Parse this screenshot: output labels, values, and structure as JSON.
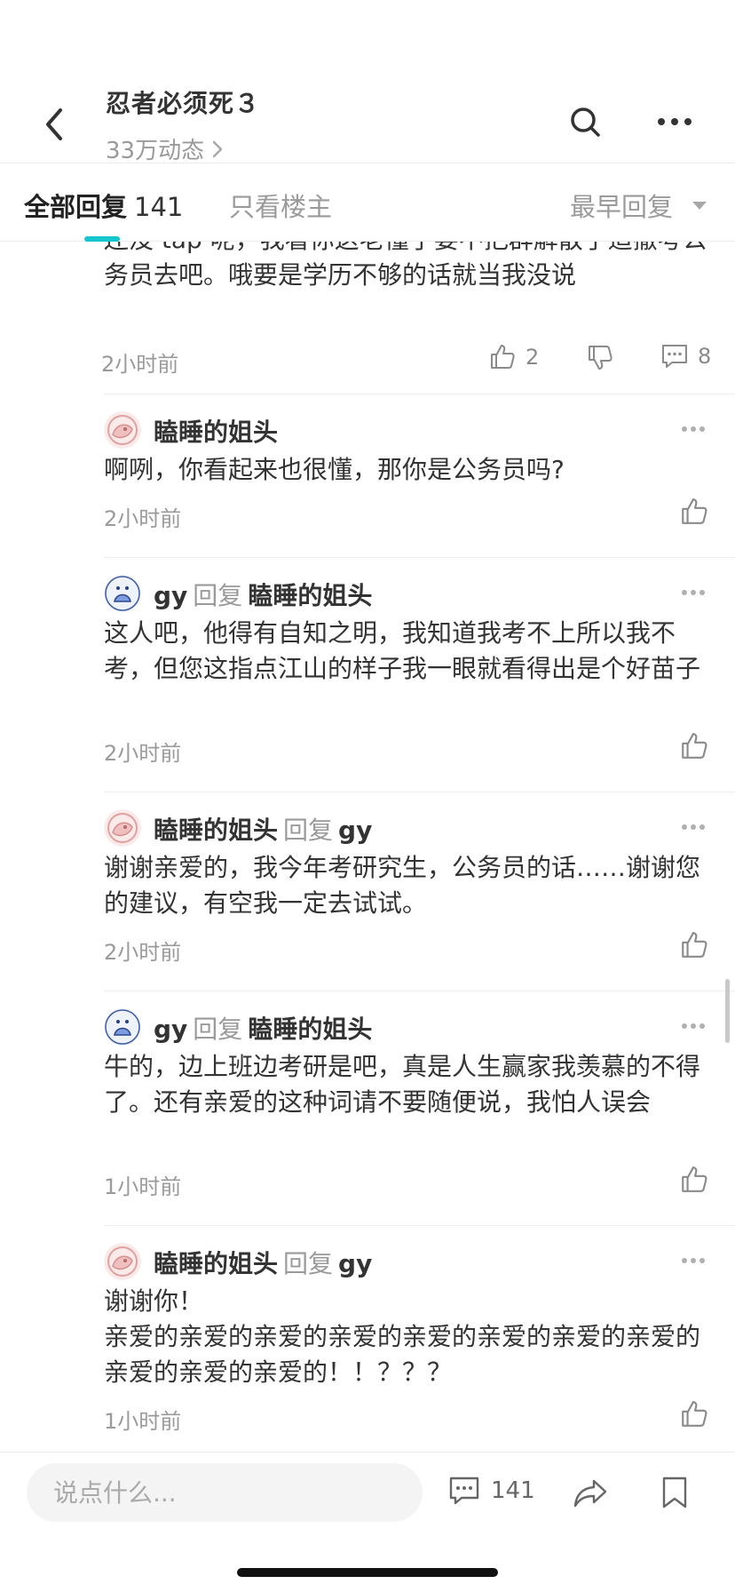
{
  "header": {
    "title": "忍者必须死３",
    "subtitle": "33万动态",
    "back_icon": "chevron-left-icon",
    "search_icon": "search-icon",
    "more_icon": "more-horizontal-icon"
  },
  "tabs": {
    "all_label": "全部回复",
    "all_count": "141",
    "op_only_label": "只看楼主",
    "sort_label": "最早回复",
    "accent_color": "#15c5ce"
  },
  "main_comment": {
    "text_tail": "还没 tap 呢，我看你这老懂了要不把群解散了适撤考公务员去吧。哦要是学历不够的话就当我没说",
    "time": "2小时前",
    "likes": "2",
    "replies": "8"
  },
  "replies": [
    {
      "author": "瞌睡的姐头",
      "reply_word": "",
      "reply_to": "",
      "text": "啊咧，你看起来也很懂，那你是公务员吗?",
      "time": "2小时前"
    },
    {
      "author": "gy",
      "reply_word": "回复",
      "reply_to": "瞌睡的姐头",
      "text": "这人吧，他得有自知之明，我知道我考不上所以我不考，但您这指点江山的样子我一眼就看得出是个好苗子",
      "time": "2小时前"
    },
    {
      "author": "瞌睡的姐头",
      "reply_word": "回复",
      "reply_to": "gy",
      "text": "谢谢亲爱的，我今年考研究生，公务员的话……谢谢您的建议，有空我一定去试试。",
      "time": "2小时前"
    },
    {
      "author": "gy",
      "reply_word": "回复",
      "reply_to": "瞌睡的姐头",
      "text": "牛的，边上班边考研是吧，真是人生赢家我羡慕的不得了。还有亲爱的这种词请不要随便说，我怕人误会",
      "time": "1小时前"
    },
    {
      "author": "瞌睡的姐头",
      "reply_word": "回复",
      "reply_to": "gy",
      "text_line1": "谢谢你！",
      "text": "亲爱的亲爱的亲爱的亲爱的亲爱的亲爱的亲爱的亲爱的亲爱的亲爱的亲爱的！！？？？",
      "time": "1小时前"
    }
  ],
  "bottom": {
    "placeholder": "说点什么...",
    "comment_count": "141",
    "comment_icon": "comment-icon",
    "share_icon": "share-icon",
    "bookmark_icon": "bookmark-icon"
  }
}
